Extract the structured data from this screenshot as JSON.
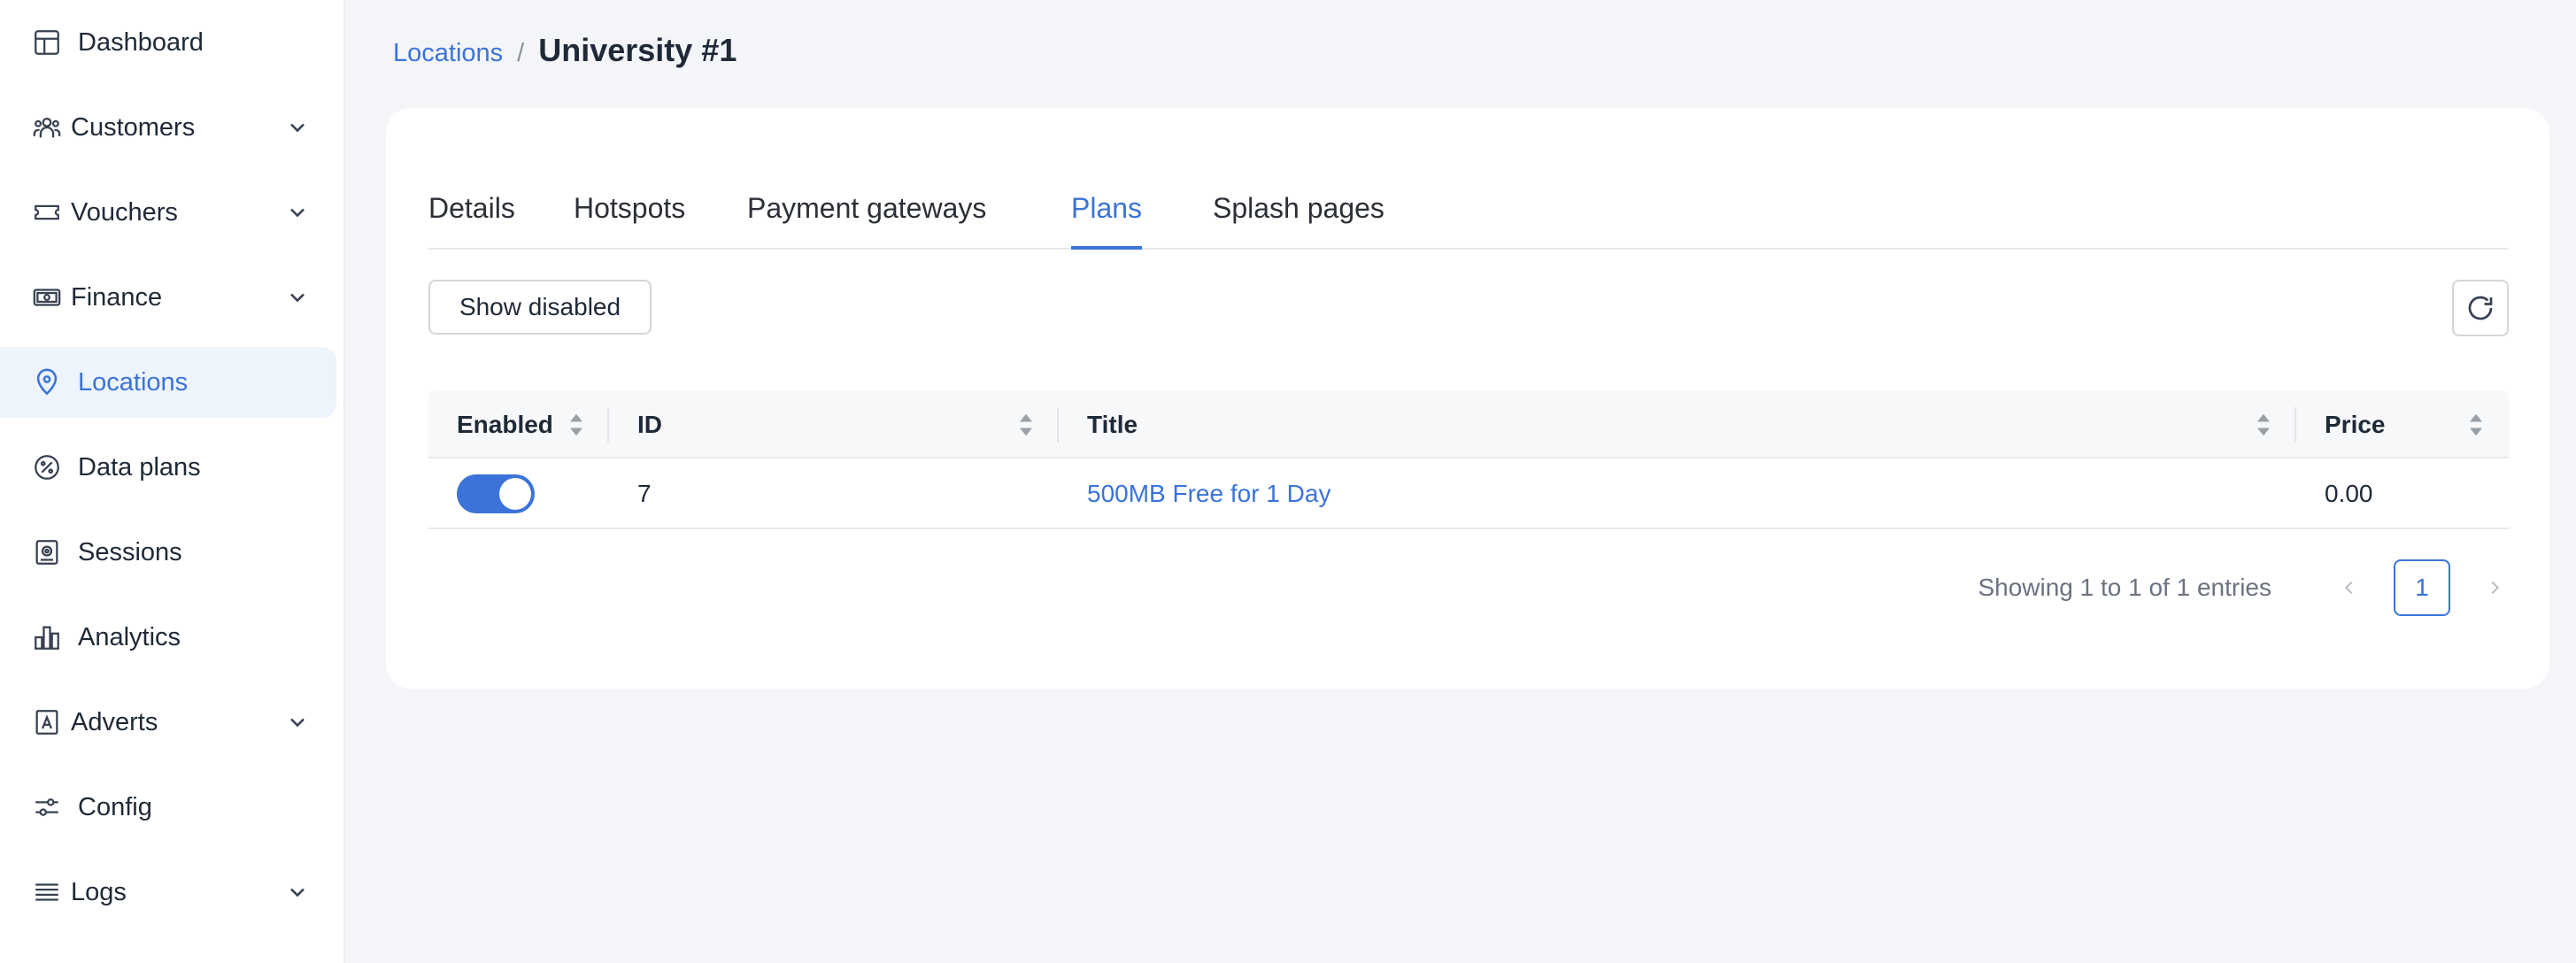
{
  "sidebar": {
    "items": [
      {
        "label": "Dashboard",
        "icon": "dashboard-icon",
        "has_chevron": false
      },
      {
        "label": "Customers",
        "icon": "users-icon",
        "has_chevron": true
      },
      {
        "label": "Vouchers",
        "icon": "ticket-icon",
        "has_chevron": true
      },
      {
        "label": "Finance",
        "icon": "cash-icon",
        "has_chevron": true
      },
      {
        "label": "Locations",
        "icon": "map-pin-icon",
        "has_chevron": false,
        "active": true
      },
      {
        "label": "Data plans",
        "icon": "percent-badge-icon",
        "has_chevron": false
      },
      {
        "label": "Sessions",
        "icon": "session-icon",
        "has_chevron": false
      },
      {
        "label": "Analytics",
        "icon": "bar-chart-icon",
        "has_chevron": false
      },
      {
        "label": "Adverts",
        "icon": "advert-icon",
        "has_chevron": true
      },
      {
        "label": "Config",
        "icon": "sliders-icon",
        "has_chevron": false
      },
      {
        "label": "Logs",
        "icon": "list-icon",
        "has_chevron": true
      }
    ]
  },
  "breadcrumb": {
    "parent": "Locations",
    "separator": "/",
    "current": "University #1"
  },
  "tabs": [
    "Details",
    "Hotspots",
    "Payment gateways",
    "Plans",
    "Splash pages"
  ],
  "active_tab": "Plans",
  "toolbar": {
    "show_disabled_label": "Show disabled",
    "refresh_icon": "refresh-icon"
  },
  "table": {
    "columns": [
      "Enabled",
      "ID",
      "Title",
      "Price"
    ],
    "rows": [
      {
        "enabled": true,
        "id": "7",
        "title": "500MB Free for 1 Day",
        "price": "0.00"
      }
    ]
  },
  "pagination": {
    "summary": "Showing 1 to 1 of 1 entries",
    "current_page": "1"
  },
  "colors": {
    "accent": "#3b73d9",
    "active_bg": "#eef4fc",
    "page_bg": "#f4f5f8"
  }
}
